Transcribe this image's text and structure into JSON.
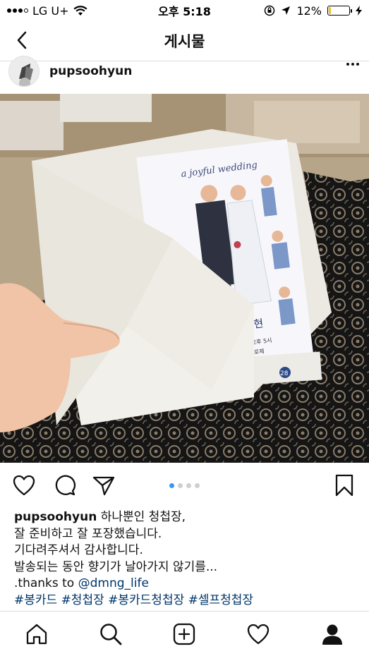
{
  "status_bar": {
    "carrier": "LG U+",
    "time": "오후 5:18",
    "battery_percent": "12%",
    "battery_level": 0.12,
    "icons": [
      "signal-icon",
      "wifi-icon",
      "rotation-lock-icon",
      "location-icon",
      "battery-icon",
      "charging-icon"
    ]
  },
  "nav": {
    "title": "게시물",
    "back_icon": "chevron-left-icon"
  },
  "post": {
    "username": "pupsoohyun",
    "more_icon": "more-horizontal-icon",
    "photo": {
      "card_heading": "a joyful wedding",
      "card_names": "지은 수현",
      "card_date": "2019.9.28.(토) 오후 5시",
      "card_venue": "이태원 보통드로제",
      "calendar_day": "28"
    },
    "carousel": {
      "count": 4,
      "active_index": 0
    },
    "actions": {
      "like_icon": "heart-icon",
      "comment_icon": "comment-icon",
      "share_icon": "send-icon",
      "save_icon": "bookmark-icon"
    },
    "caption": {
      "username": "pupsoohyun",
      "line1": " 하나뿐인 청첩장,",
      "line2": "잘 준비하고 잘 포장했습니다.",
      "line3": "기다려주셔서 감사합니다.",
      "line4": "발송되는 동안 향기가 날아가지 않기를...",
      "line5_prefix": ".thanks to ",
      "line5_mention": "@dmng_life",
      "hashtags": "#봉카드 #청첩장 #봉카드청첩장 #셀프청첩장"
    }
  },
  "tab_bar": {
    "tabs": [
      "home-icon",
      "search-icon",
      "add-post-icon",
      "activity-heart-icon",
      "profile-icon"
    ]
  }
}
